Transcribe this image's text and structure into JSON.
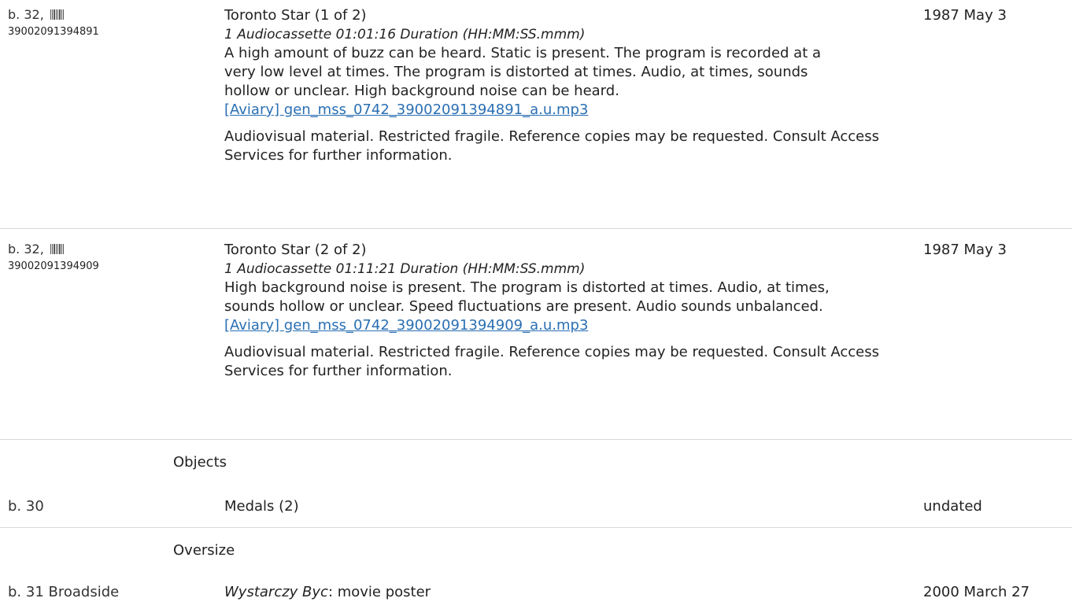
{
  "items": [
    {
      "location": "b. 32,",
      "barcode": "39002091394891",
      "title": "Toronto Star (1 of 2)",
      "physdesc": "1 Audiocassette  01:01:16 Duration (HH:MM:SS.mmm)",
      "note": "A high amount of buzz can be heard. Static is present. The program is recorded at a very low level at times. The program is distorted at times. Audio, at times, sounds hollow or unclear. High background noise can be heard.",
      "link": "[Aviary] gen_mss_0742_39002091394891_a.u.mp3",
      "access": "Audiovisual material. Restricted fragile. Reference copies may be requested. Consult Access Services for further information.",
      "date": "1987 May 3"
    },
    {
      "location": "b. 32,",
      "barcode": "39002091394909",
      "title": "Toronto Star (2 of 2)",
      "physdesc": "1 Audiocassette  01:11:21 Duration (HH:MM:SS.mmm)",
      "note": "High background noise is present. The program is distorted at times. Audio, at times, sounds hollow or unclear. Speed fluctuations are present. Audio sounds unbalanced.",
      "link": "[Aviary] gen_mss_0742_39002091394909_a.u.mp3",
      "access": "Audiovisual material. Restricted fragile. Reference copies may be requested. Consult Access Services for further information.",
      "date": "1987 May 3"
    }
  ],
  "objects": {
    "heading": "Objects",
    "location": "b. 30",
    "title": "Medals (2)",
    "date": "undated"
  },
  "oversize": {
    "heading": "Oversize",
    "location": "b. 31 Broadside",
    "title_italic": "Wystarczy Byc",
    "title_rest": ": movie poster",
    "date": "2000 March 27"
  },
  "colors": {
    "link": "#2a6fb3",
    "separator": "#d9d9d9",
    "text": "#222222"
  }
}
